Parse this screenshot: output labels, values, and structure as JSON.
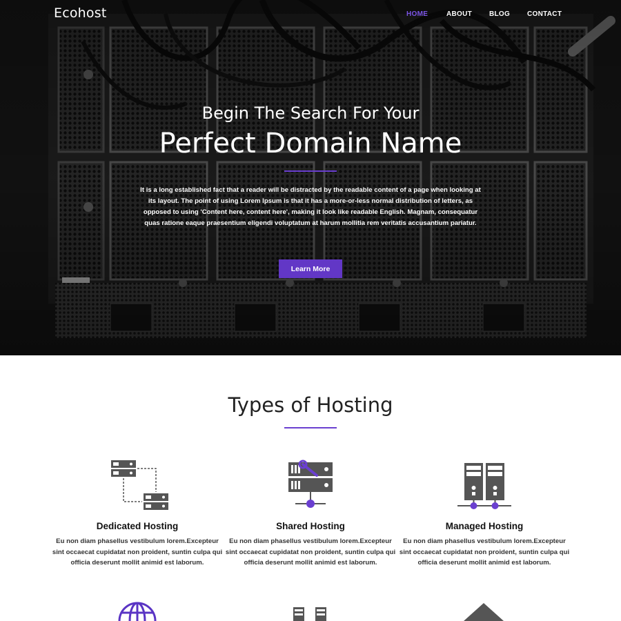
{
  "navbar": {
    "brand": "Ecohost",
    "links": [
      {
        "label": "HOME",
        "active": true
      },
      {
        "label": "ABOUT",
        "active": false
      },
      {
        "label": "BLOG",
        "active": false
      },
      {
        "label": "CONTACT",
        "active": false
      }
    ]
  },
  "hero": {
    "subtitle": "Begin The Search For Your",
    "title": "Perfect Domain Name",
    "text": "It is a long established fact that a reader will be distracted by the readable content of a page when looking at its layout. The point of using Lorem Ipsum is that it has a more-or-less normal distribution of letters, as opposed to using 'Content here, content here', making it look like readable English. Magnam, consequatur quas ratione eaque praesentium eligendi voluptatum at harum mollitia rem veritatis accusantium pariatur.",
    "button_label": "Learn More"
  },
  "hosting": {
    "title": "Types of Hosting",
    "cards": [
      {
        "icon": "dedicated-servers-icon",
        "title": "Dedicated Hosting",
        "text": "Eu non diam phasellus vestibulum lorem.Excepteur sint occaecat cupidatat non proident, suntin culpa qui officia deserunt mollit animid est laborum."
      },
      {
        "icon": "shared-server-wrench-icon",
        "title": "Shared Hosting",
        "text": "Eu non diam phasellus vestibulum lorem.Excepteur sint occaecat cupidatat non proident, suntin culpa qui officia deserunt mollit animid est laborum."
      },
      {
        "icon": "managed-servers-icon",
        "title": "Managed Hosting",
        "text": "Eu non diam phasellus vestibulum lorem.Excepteur sint occaecat cupidatat non proident, suntin culpa qui officia deserunt mollit animid est laborum."
      }
    ],
    "next_row_icons": [
      "globe-icon",
      "server-pair-icon",
      "cloud-triangle-icon"
    ]
  },
  "colors": {
    "accent": "#6237c6",
    "nav_active": "#7b54e6",
    "icon_gray": "#555555"
  }
}
